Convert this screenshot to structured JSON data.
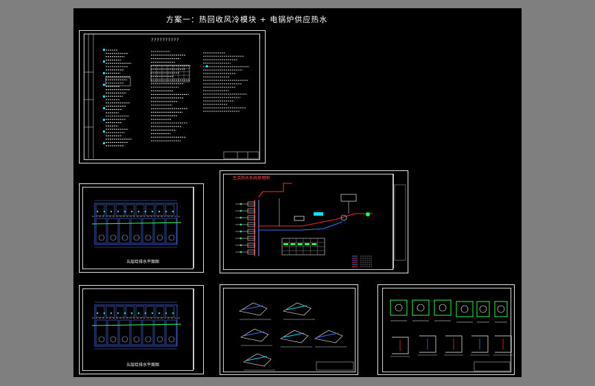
{
  "drawing": {
    "title": "方案一：热回收风冷模块 + 电锅炉供应热水"
  },
  "sheets": {
    "design_notes": {
      "heading": "??????????"
    },
    "floor_plan_1": {
      "caption": "五层给排水平面图"
    },
    "floor_plan_2": {
      "caption": "五层给排水平面图"
    },
    "system_diagram": {
      "caption": "生活热水系统原理图"
    },
    "details": {},
    "equipment": {}
  },
  "colors": {
    "background": "#000000",
    "frame": "#e8e8e8",
    "pipe_blue": "#3b6cff",
    "pipe_red": "#ff2a2a",
    "pipe_cyan": "#00e5ff",
    "pipe_green": "#22ff55",
    "text_white": "#f2f2f2"
  }
}
